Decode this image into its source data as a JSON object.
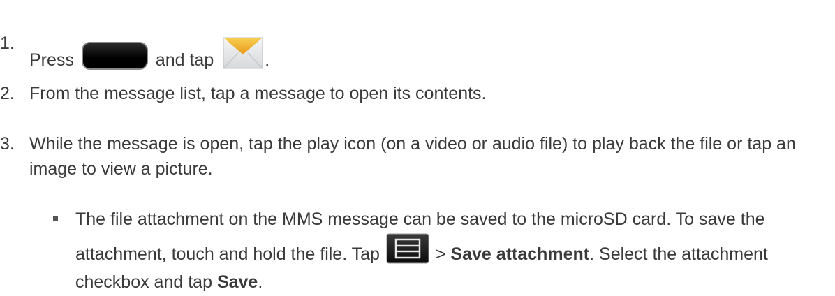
{
  "steps": [
    {
      "number": "1.",
      "part1": "Press",
      "part2": "and tap",
      "part3": ".",
      "icons": [
        "home-key-icon",
        "messaging-envelope-icon"
      ]
    },
    {
      "number": "2.",
      "text": "From the message list, tap a message to open its contents."
    },
    {
      "number": "3.",
      "text": "While the message is open, tap the play icon (on a video or audio file) to play back the file or tap an image to view a picture."
    }
  ],
  "bullet": {
    "text_a": "The file attachment on the MMS message can be saved to the microSD card. To save the attachment, touch and hold the file. Tap",
    "text_b": ">",
    "bold_1": "Save attachment",
    "text_c": ". Select the attachment checkbox and tap",
    "bold_2": "Save",
    "text_d": ".",
    "icon": "menu-key-icon"
  },
  "colors": {
    "text": "#3a3a3a",
    "envelope_flap": "#f4b52a",
    "key_dark": "#000000"
  }
}
